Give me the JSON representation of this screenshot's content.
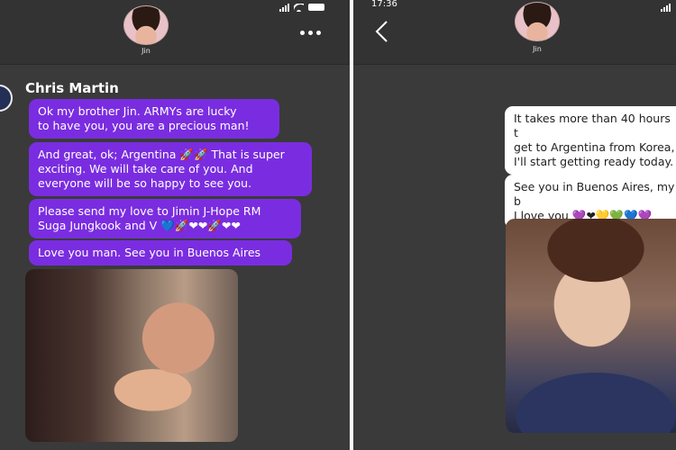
{
  "left_screen": {
    "contact_name": "Jin",
    "sender_name": "Chris Martin",
    "messages": [
      {
        "lines": [
          "Ok my brother Jin. ARMYs are lucky",
          "to have you, you are a precious man!"
        ]
      },
      {
        "lines": [
          "And great, ok; Argentina 🚀🚀 That is super",
          "exciting. We will take care of you. And",
          "everyone will be so happy to see you."
        ]
      },
      {
        "lines": [
          "Please send my love to Jimin J-Hope RM",
          "Suga Jungkook and V 💙🚀❤❤🚀❤❤"
        ]
      },
      {
        "lines": [
          "Love you man. See you in Buenos Aires"
        ]
      }
    ]
  },
  "right_screen": {
    "status_time": "17:36",
    "contact_name": "Jin",
    "messages": [
      {
        "lines": [
          "It takes more than 40 hours t",
          "get to Argentina from Korea,",
          "I'll start getting ready today."
        ]
      },
      {
        "lines": [
          "See you in Buenos Aires, my b",
          "I love you 💜❤💛💚💙💜"
        ]
      }
    ]
  },
  "colors": {
    "background": "#3a3a3a",
    "purple_bubble": "#7a2de0",
    "white_bubble": "#ffffff"
  }
}
